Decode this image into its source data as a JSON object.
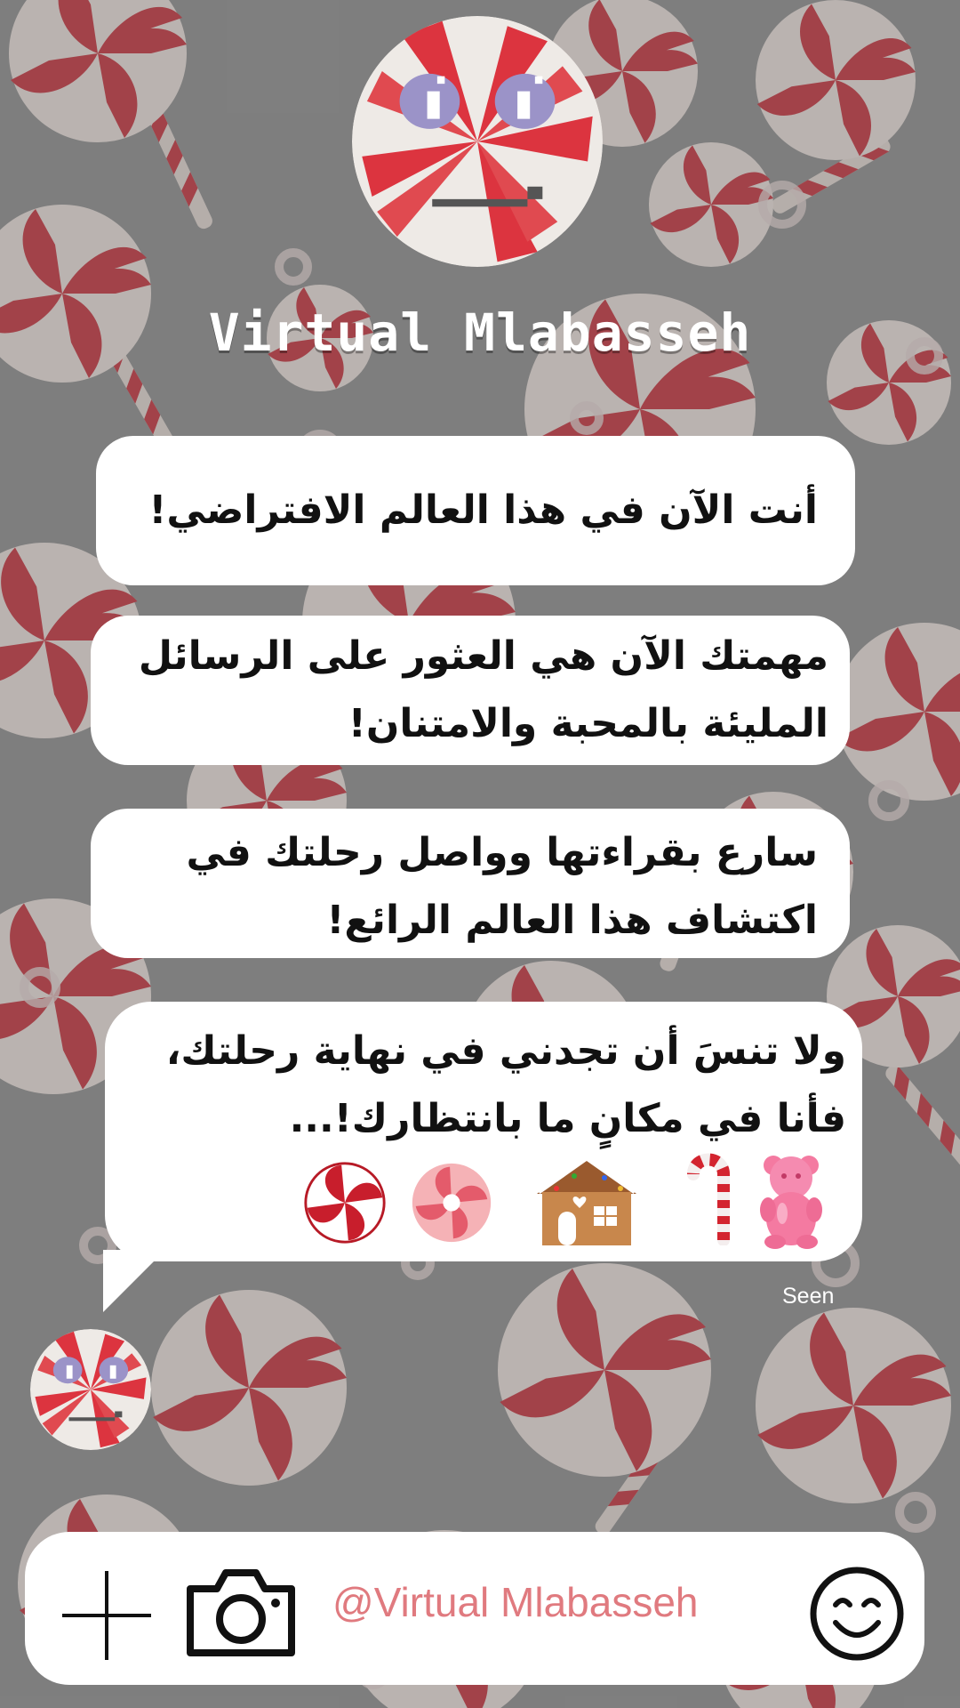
{
  "header": {
    "title": "Virtual Mlabasseh"
  },
  "messages": [
    {
      "lines": [
        "أنت الآن في هذا العالم الافتراضي!"
      ]
    },
    {
      "lines": [
        "مهمتك الآن هي العثور على الرسائل",
        "المليئة بالمحبة والامتنان!"
      ]
    },
    {
      "lines": [
        "سارع بقراءتها وواصل رحلتك في",
        "اكتشاف هذا العالم الرائع!"
      ]
    },
    {
      "lines": [
        "ولا تنسَ أن تجدني في نهاية رحلتك،",
        "فأنا في مكانٍ ما بانتظارك!..."
      ]
    }
  ],
  "candies": [
    "gummy-bear-icon",
    "candy-cane-icon",
    "gingerbread-house-icon",
    "pink-lollipop-icon",
    "red-peppermint-icon"
  ],
  "status": {
    "seen": "Seen"
  },
  "composer": {
    "handle": "@Virtual Mlabasseh",
    "icons": [
      "plus-icon",
      "camera-icon",
      "smiley-icon"
    ]
  },
  "colors": {
    "accent": "#e07a7f",
    "candy_red": "#d6283a",
    "bubble": "#ffffff"
  }
}
